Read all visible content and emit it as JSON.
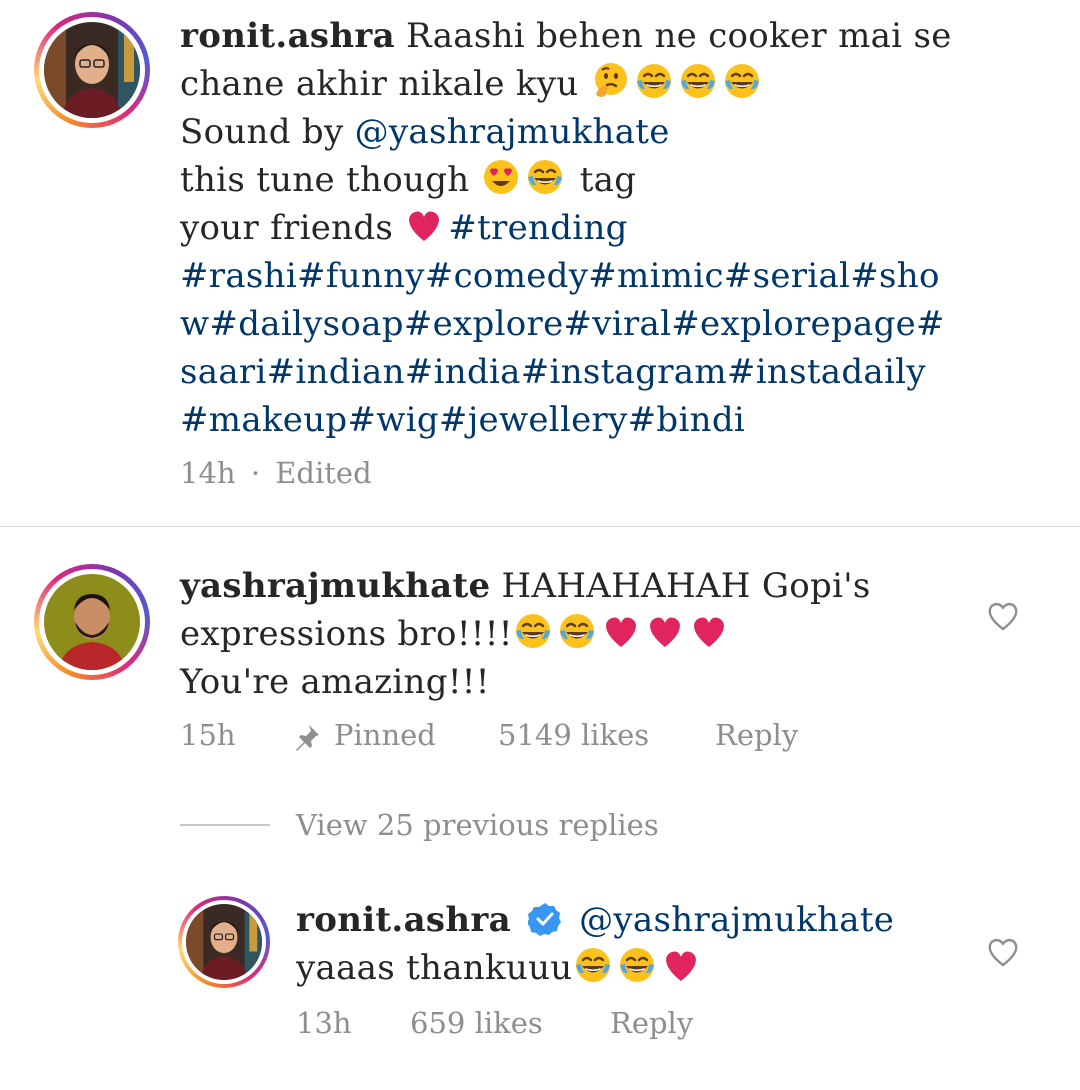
{
  "caption": {
    "username": "ronit.ashra",
    "line1_text": "Raashi behen ne cooker mai se",
    "line2_text": "chane akhir nikale kyu",
    "line3_prefix": "Sound by ",
    "line3_mention": "@yashrajmukhate",
    "line4_a": "this tune though",
    "line4_b": "tag",
    "line5_a": "your friends",
    "hashtags_line1": "#trending",
    "hashtags_line2": "#rashi#funny#comedy#mimic#serial#sho",
    "hashtags_line3": "w#dailysoap#explore#viral#explorepage#",
    "hashtags_line4": "saari#indian#india#instagram#instadaily",
    "hashtags_line5": "#makeup#wig#jewellery#bindi",
    "time": "14h",
    "separator": "·",
    "edited": "Edited"
  },
  "comment": {
    "username": "yashrajmukhate",
    "line1_text": "HAHAHAHAH Gopi's",
    "line2_text": "expressions bro!!!!",
    "line3_text": "You're amazing!!!",
    "time": "15h",
    "pinned": "Pinned",
    "likes": "5149 likes",
    "reply": "Reply",
    "heart_icon": "heart-outline-icon"
  },
  "view_replies": "View 25 previous replies",
  "reply": {
    "username": "ronit.ashra",
    "verified_icon": "verified-badge-icon",
    "mention": "@yashrajmukhate",
    "line2_text": "yaaas thankuuu",
    "time": "13h",
    "likes": "659 likes",
    "reply": "Reply",
    "heart_icon": "heart-outline-icon"
  },
  "colors": {
    "link": "#00376b",
    "meta": "#8e8e8e",
    "text": "#262626",
    "verified": "#3897f0",
    "heart_red": "#e0245e"
  }
}
